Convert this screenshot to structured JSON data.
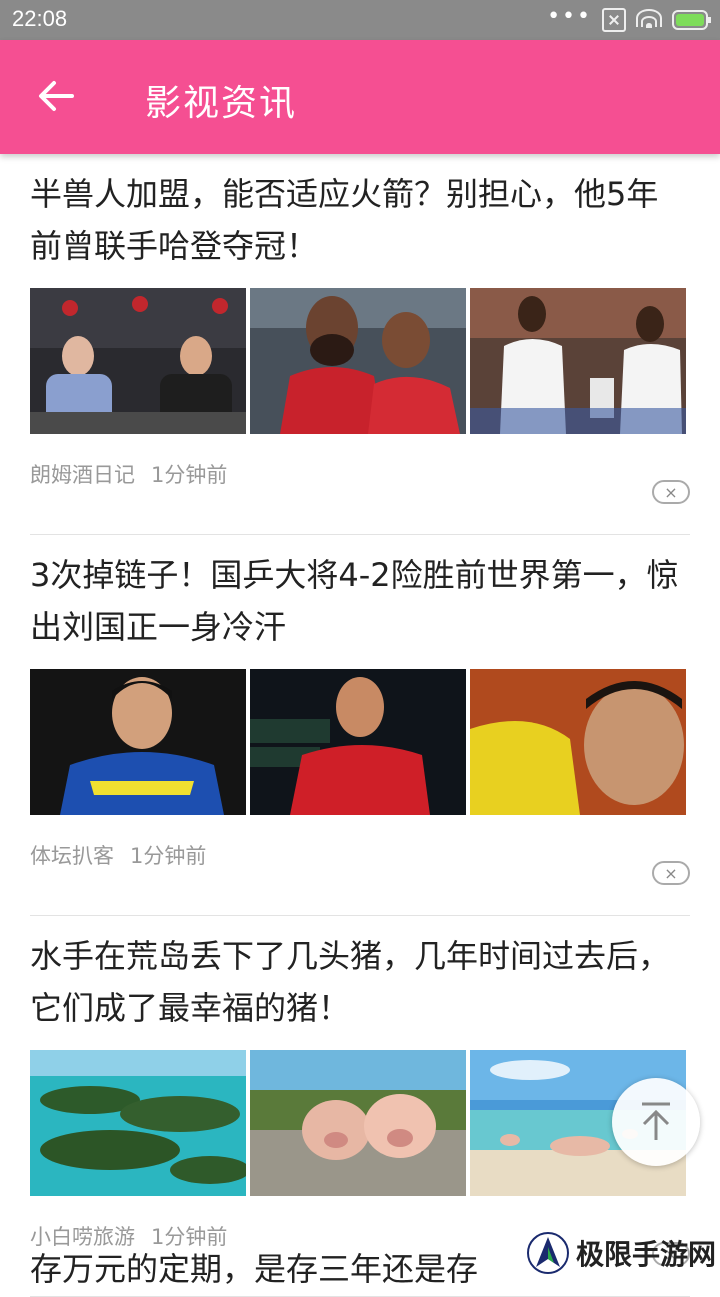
{
  "status": {
    "time": "22:08",
    "dots": "•••"
  },
  "header": {
    "title": "影视资讯"
  },
  "articles": [
    {
      "title": "半兽人加盟，能否适应火箭？别担心，他5年前曾联手哈登夺冠！",
      "source": "朗姆酒日记",
      "time": "1分钟前"
    },
    {
      "title": "3次掉链子！国乒大将4-2险胜前世界第一，惊出刘国正一身冷汗",
      "source": "体坛扒客",
      "time": "1分钟前"
    },
    {
      "title": "水手在荒岛丢下了几头猪，几年时间过去后，它们成了最幸福的猪！",
      "source": "小白唠旅游",
      "time": "1分钟前"
    }
  ],
  "next_article": {
    "title": "存万元的定期，是存三年还是存"
  },
  "close_glyph": "×",
  "watermark": {
    "text": "极限手游网"
  },
  "colors": {
    "appbar": "#f54f92",
    "statusbar": "#8a8a8a"
  }
}
